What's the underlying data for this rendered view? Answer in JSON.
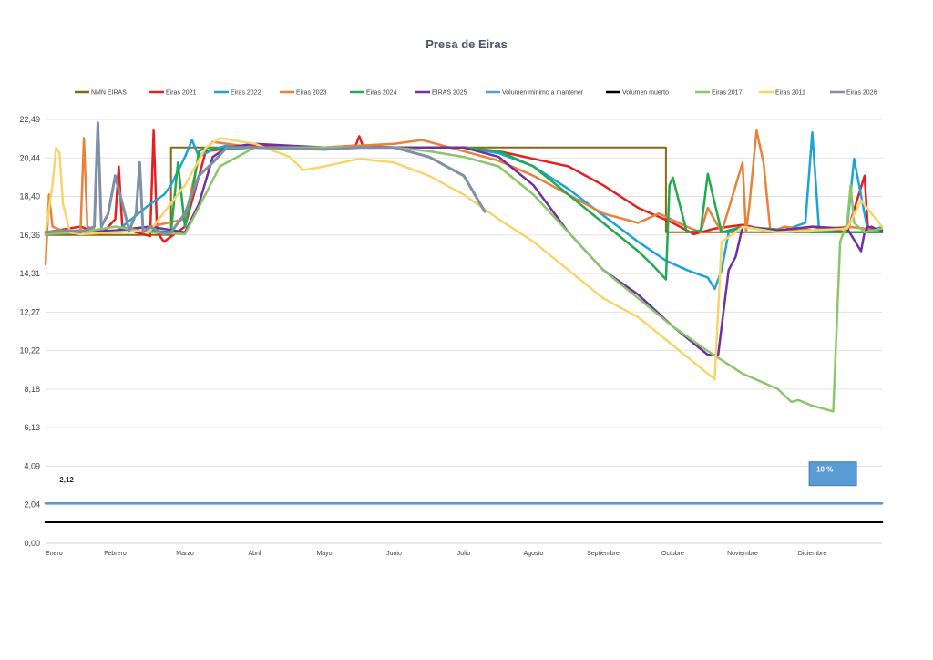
{
  "chart_data": {
    "type": "line",
    "title": "Presa de Eiras",
    "xlabel": "",
    "ylabel": "",
    "ylim": [
      0,
      22.49
    ],
    "y_ticks": [
      "0,00",
      "2,04",
      "4,09",
      "6,13",
      "8,18",
      "10,22",
      "12,27",
      "14,31",
      "16,36",
      "18,40",
      "20,44",
      "22,49"
    ],
    "x_labels": [
      "Enero",
      "Febrero",
      "Marzo",
      "Abril",
      "Mayo",
      "Junio",
      "Julio",
      "Agosto",
      "Septiembre",
      "Octubre",
      "Noviembre",
      "Diciembre"
    ],
    "grid": "horizontal",
    "legend_position": "top",
    "annotations": [
      {
        "text": "2,12",
        "x": 0.2,
        "y": 3.2
      },
      {
        "text": "10 %",
        "x": 11.4,
        "y": 3.4
      }
    ],
    "series": [
      {
        "name": "NMN EIRAS",
        "color": "#8b6914",
        "width": 2,
        "x": [
          0,
          1.8,
          1.8,
          8.9,
          8.9,
          12
        ],
        "y": [
          16.36,
          16.36,
          21.0,
          21.0,
          16.5,
          16.5
        ]
      },
      {
        "name": "Eiras 2021",
        "color": "#e81e1e",
        "width": 2.5,
        "x": [
          0,
          0.5,
          0.8,
          1.0,
          1.05,
          1.1,
          1.3,
          1.5,
          1.55,
          1.6,
          1.7,
          2.0,
          2.3,
          3,
          4,
          4.45,
          4.5,
          4.55,
          5,
          6,
          6.5,
          7,
          7.5,
          8,
          8.5,
          9,
          9.3,
          9.6,
          10,
          10.5,
          11,
          11.5,
          11.75,
          11.8,
          11.85,
          12
        ],
        "y": [
          16.5,
          16.8,
          16.4,
          17.2,
          20.0,
          16.8,
          16.5,
          16.3,
          21.9,
          16.5,
          16.0,
          16.8,
          20.8,
          21.1,
          21.0,
          21.1,
          21.6,
          21.1,
          21.0,
          21.0,
          20.8,
          20.4,
          20.0,
          19.0,
          17.8,
          17.0,
          16.4,
          16.7,
          16.9,
          16.5,
          16.8,
          16.5,
          19.5,
          16.6,
          16.8,
          16.5
        ]
      },
      {
        "name": "Eiras 2022",
        "color": "#1aa3dc",
        "width": 2.5,
        "x": [
          0,
          0.5,
          1.0,
          1.5,
          1.7,
          1.8,
          2.0,
          2.1,
          2.2,
          2.4,
          2.6,
          3,
          4,
          5,
          6,
          6.5,
          7,
          7.5,
          8,
          8.5,
          8.9,
          9.2,
          9.5,
          9.6,
          9.7,
          9.8,
          10,
          10.5,
          10.9,
          11.0,
          11.1,
          11.5,
          11.6,
          11.8,
          12
        ],
        "y": [
          16.5,
          16.6,
          16.5,
          18.0,
          18.5,
          19.0,
          20.5,
          21.4,
          20.5,
          20.9,
          21.1,
          21.0,
          21.0,
          21.0,
          21.0,
          20.7,
          20.0,
          18.8,
          17.4,
          16.0,
          15.0,
          14.5,
          14.1,
          13.5,
          14.5,
          16.5,
          16.8,
          16.5,
          17.0,
          21.8,
          16.5,
          16.8,
          20.4,
          16.5,
          16.8
        ]
      },
      {
        "name": "Eiras 2023",
        "color": "#e8823a",
        "width": 2.5,
        "x": [
          0,
          0.05,
          0.1,
          0.3,
          0.5,
          0.55,
          0.6,
          0.8,
          1.0,
          1.5,
          2.0,
          2.2,
          2.4,
          3,
          4,
          5,
          5.4,
          6,
          6.5,
          7,
          7.5,
          8,
          8.5,
          8.8,
          9.2,
          9.4,
          9.5,
          9.7,
          10,
          10.05,
          10.1,
          10.2,
          10.3,
          10.4,
          10.6,
          11,
          11.5,
          12
        ],
        "y": [
          14.8,
          18.5,
          16.8,
          16.5,
          16.5,
          21.5,
          16.8,
          16.5,
          16.6,
          16.8,
          17.2,
          20.5,
          21.3,
          21.0,
          21.0,
          21.2,
          21.4,
          20.8,
          20.3,
          19.5,
          18.5,
          17.5,
          17.0,
          17.5,
          16.8,
          16.5,
          17.8,
          16.5,
          20.2,
          16.5,
          18.0,
          21.9,
          20.2,
          16.5,
          16.8,
          16.6,
          16.8,
          16.6
        ]
      },
      {
        "name": "Eiras 2024",
        "color": "#22aa4f",
        "width": 2.5,
        "x": [
          0,
          0.5,
          1.0,
          1.5,
          1.8,
          1.9,
          2.0,
          2.1,
          2.2,
          2.3,
          2.5,
          3,
          4,
          5,
          6,
          6.5,
          7,
          7.5,
          8,
          8.5,
          8.7,
          8.9,
          8.95,
          9.0,
          9.2,
          9.4,
          9.5,
          9.7,
          10,
          11,
          12
        ],
        "y": [
          16.4,
          16.5,
          16.5,
          16.6,
          16.5,
          20.2,
          16.8,
          18.5,
          20.8,
          21.0,
          20.9,
          21.0,
          21.0,
          21.0,
          21.0,
          20.8,
          20.0,
          18.5,
          17.0,
          15.5,
          14.8,
          14.0,
          19.0,
          19.4,
          16.5,
          16.6,
          19.6,
          16.5,
          16.8,
          16.5,
          16.5
        ]
      },
      {
        "name": "EIRAS 2025",
        "color": "#7030a0",
        "width": 2.5,
        "x": [
          0,
          0.5,
          1.0,
          1.5,
          2.0,
          2.2,
          2.4,
          2.6,
          3,
          4,
          5,
          6,
          6.5,
          7,
          7.5,
          8,
          8.5,
          9,
          9.5,
          9.65,
          9.8,
          9.9,
          10,
          10.5,
          11,
          11.5,
          11.7,
          11.75,
          11.8,
          12
        ],
        "y": [
          16.4,
          16.5,
          16.6,
          16.8,
          16.5,
          18.0,
          20.5,
          21.0,
          21.2,
          21.0,
          21.0,
          21.0,
          20.5,
          19.0,
          16.5,
          14.5,
          13.2,
          11.5,
          10.0,
          10.0,
          14.5,
          15.2,
          16.8,
          16.6,
          16.8,
          16.7,
          15.5,
          16.5,
          16.8,
          16.6
        ]
      },
      {
        "name": "Volumen minimo a mantener",
        "color": "#5b9bd5",
        "width": 2.5,
        "x": [
          0,
          12
        ],
        "y": [
          2.12,
          2.12
        ]
      },
      {
        "name": "Volumen muerto",
        "color": "#000000",
        "width": 2.5,
        "x": [
          0,
          12
        ],
        "y": [
          1.12,
          1.12
        ]
      },
      {
        "name": "Eiras 2017",
        "color": "#8cc66b",
        "width": 2.5,
        "x": [
          0,
          0.5,
          1.0,
          1.5,
          2.0,
          2.5,
          3,
          4,
          5,
          5.5,
          6,
          6.5,
          7,
          7.5,
          8,
          8.5,
          9,
          9.5,
          10,
          10.5,
          10.7,
          10.8,
          11,
          11.3,
          11.4,
          11.5,
          11.55,
          11.6,
          11.75,
          12
        ],
        "y": [
          16.4,
          16.5,
          16.8,
          16.5,
          16.4,
          20.0,
          21.0,
          21.0,
          21.0,
          20.8,
          20.5,
          20.0,
          18.5,
          16.5,
          14.5,
          13.0,
          11.5,
          10.2,
          9.0,
          8.2,
          7.5,
          7.6,
          7.3,
          7.0,
          16.0,
          17.0,
          19.0,
          17.0,
          16.5,
          16.7
        ]
      },
      {
        "name": "Eiras 2011",
        "color": "#f7d56b",
        "width": 2.5,
        "x": [
          0,
          0.1,
          0.15,
          0.2,
          0.25,
          0.35,
          0.5,
          1.0,
          1.5,
          2.0,
          2.3,
          2.5,
          3,
          3.5,
          3.7,
          4,
          4.5,
          5,
          5.5,
          6,
          6.5,
          7,
          7.5,
          8,
          8.5,
          9,
          9.5,
          9.6,
          9.7,
          9.9,
          10,
          10.5,
          11,
          11.5,
          11.7,
          12
        ],
        "y": [
          16.5,
          19.0,
          21.0,
          20.7,
          18.0,
          16.5,
          16.4,
          16.5,
          16.6,
          19.0,
          21.0,
          21.5,
          21.2,
          20.5,
          19.8,
          20.0,
          20.4,
          20.2,
          19.5,
          18.5,
          17.2,
          16.0,
          14.5,
          13.0,
          12.0,
          10.5,
          9.0,
          8.7,
          16.0,
          16.5,
          16.8,
          16.5,
          16.6,
          16.7,
          18.2,
          16.8
        ]
      },
      {
        "name": "Eiras 2026",
        "color": "#7f8fa6",
        "width": 3,
        "x": [
          0,
          0.3,
          0.5,
          0.7,
          0.75,
          0.8,
          0.9,
          1.0,
          1.2,
          1.3,
          1.35,
          1.4,
          1.5,
          1.6,
          1.7,
          1.8,
          2.0,
          2.2,
          2.4,
          2.6,
          3,
          4,
          4.5,
          5,
          5.5,
          6,
          6.3
        ],
        "y": [
          16.5,
          16.6,
          16.5,
          16.8,
          22.3,
          16.8,
          17.5,
          19.5,
          16.6,
          17.5,
          20.2,
          16.5,
          16.8,
          16.6,
          16.4,
          16.5,
          17.5,
          19.5,
          20.2,
          21.0,
          21.0,
          20.9,
          21.0,
          21.0,
          20.5,
          19.5,
          17.6
        ]
      }
    ]
  }
}
